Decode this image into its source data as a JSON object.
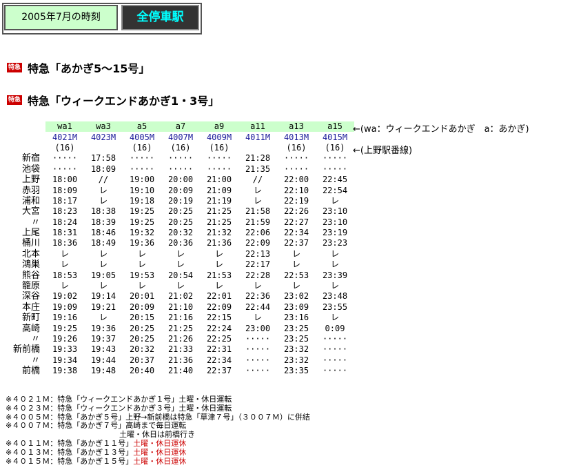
{
  "header": {
    "date_label": "2005年7月の時刻",
    "all_stations_link": "全停車駅"
  },
  "sections": [
    {
      "badge": "特急",
      "title": "特急「あかぎ5〜15号」"
    },
    {
      "badge": "特急",
      "title": "特急「ウィークエンドあかぎ1・3号」"
    }
  ],
  "legend_note": "←(wa：ウィークエンドあかぎ　a：あかぎ)",
  "platform_note": "←(上野駅番線)",
  "trains": [
    "wa1",
    "wa3",
    "a5",
    "a7",
    "a9",
    "a11",
    "a13",
    "a15"
  ],
  "train_numbers": [
    "4021M",
    "4023M",
    "4005M",
    "4007M",
    "4009M",
    "4011M",
    "4013M",
    "4015M"
  ],
  "platforms": [
    "(16)",
    "",
    "(16)",
    "(16)",
    "(16)",
    "",
    "(16)",
    "(16)"
  ],
  "stations": [
    {
      "name": "新宿",
      "times": [
        "·····",
        "17:58",
        "·····",
        "·····",
        "·····",
        "21:28",
        "·····",
        "·····"
      ]
    },
    {
      "name": "池袋",
      "times": [
        "·····",
        "18:09",
        "·····",
        "·····",
        "·····",
        "21:35",
        "·····",
        "·····"
      ]
    },
    {
      "name": "上野",
      "times": [
        "18:00",
        "//",
        "19:00",
        "20:00",
        "21:00",
        "//",
        "22:00",
        "22:45"
      ]
    },
    {
      "name": "赤羽",
      "times": [
        "18:09",
        "レ",
        "19:10",
        "20:09",
        "21:09",
        "レ",
        "22:10",
        "22:54"
      ]
    },
    {
      "name": "浦和",
      "times": [
        "18:17",
        "レ",
        "19:18",
        "20:19",
        "21:19",
        "レ",
        "22:19",
        "レ"
      ]
    },
    {
      "name": "大宮",
      "times": [
        "18:23",
        "18:38",
        "19:25",
        "20:25",
        "21:25",
        "21:58",
        "22:26",
        "23:10"
      ]
    },
    {
      "name": "〃",
      "times": [
        "18:24",
        "18:39",
        "19:25",
        "20:25",
        "21:25",
        "21:59",
        "22:27",
        "23:10"
      ]
    },
    {
      "name": "上尾",
      "times": [
        "18:31",
        "18:46",
        "19:32",
        "20:32",
        "21:32",
        "22:06",
        "22:34",
        "23:19"
      ]
    },
    {
      "name": "桶川",
      "times": [
        "18:36",
        "18:49",
        "19:36",
        "20:36",
        "21:36",
        "22:09",
        "22:37",
        "23:23"
      ]
    },
    {
      "name": "北本",
      "times": [
        "レ",
        "レ",
        "レ",
        "レ",
        "レ",
        "22:13",
        "レ",
        "レ"
      ]
    },
    {
      "name": "鴻巣",
      "times": [
        "レ",
        "レ",
        "レ",
        "レ",
        "レ",
        "22:17",
        "レ",
        "レ"
      ]
    },
    {
      "name": "熊谷",
      "times": [
        "18:53",
        "19:05",
        "19:53",
        "20:54",
        "21:53",
        "22:28",
        "22:53",
        "23:39"
      ]
    },
    {
      "name": "籠原",
      "times": [
        "レ",
        "レ",
        "レ",
        "レ",
        "レ",
        "レ",
        "レ",
        "レ"
      ]
    },
    {
      "name": "深谷",
      "times": [
        "19:02",
        "19:14",
        "20:01",
        "21:02",
        "22:01",
        "22:36",
        "23:02",
        "23:48"
      ]
    },
    {
      "name": "本庄",
      "times": [
        "19:09",
        "19:21",
        "20:09",
        "21:10",
        "22:09",
        "22:44",
        "23:09",
        "23:55"
      ]
    },
    {
      "name": "新町",
      "times": [
        "19:16",
        "レ",
        "20:15",
        "21:16",
        "22:15",
        "レ",
        "23:16",
        "レ"
      ]
    },
    {
      "name": "高崎",
      "times": [
        "19:25",
        "19:36",
        "20:25",
        "21:25",
        "22:24",
        "23:00",
        "23:25",
        "0:09"
      ]
    },
    {
      "name": "〃",
      "times": [
        "19:26",
        "19:37",
        "20:25",
        "21:26",
        "22:25",
        "·····",
        "23:25",
        "·····"
      ]
    },
    {
      "name": "新前橋",
      "times": [
        "19:33",
        "19:43",
        "20:32",
        "21:33",
        "22:31",
        "·····",
        "23:32",
        "·····"
      ]
    },
    {
      "name": "〃",
      "times": [
        "19:34",
        "19:44",
        "20:37",
        "21:36",
        "22:34",
        "·····",
        "23:32",
        "·····"
      ]
    },
    {
      "name": "前橋",
      "times": [
        "19:38",
        "19:48",
        "20:40",
        "21:40",
        "22:37",
        "·····",
        "23:35",
        "·····"
      ]
    }
  ],
  "notes": [
    {
      "text": "※４０２１Ｍ：特急「ウィークエンドあかぎ１号」土曜・休日運転",
      "red": ""
    },
    {
      "text": "※４０２３Ｍ：特急「ウィークエンドあかぎ３号」土曜・休日運転",
      "red": ""
    },
    {
      "text": "※４００５Ｍ：特急「あかぎ５号」上野→新前橋は特急「草津７号」（３００７Ｍ）に併結",
      "red": ""
    },
    {
      "text": "※４００７Ｍ：特急「あかぎ７号」高崎まで毎日運転",
      "red": ""
    },
    {
      "text": "　　　　　　　　　　　　　　　土曜・休日は前橋行き",
      "red": ""
    },
    {
      "text": "※４０１１Ｍ：特急「あかぎ１１号」",
      "red": "土曜・休日運休"
    },
    {
      "text": "※４０１３Ｍ：特急「あかぎ１３号」",
      "red": "土曜・休日運休"
    },
    {
      "text": "※４０１５Ｍ：特急「あかぎ１５号」",
      "red": "土曜・休日運休"
    }
  ]
}
